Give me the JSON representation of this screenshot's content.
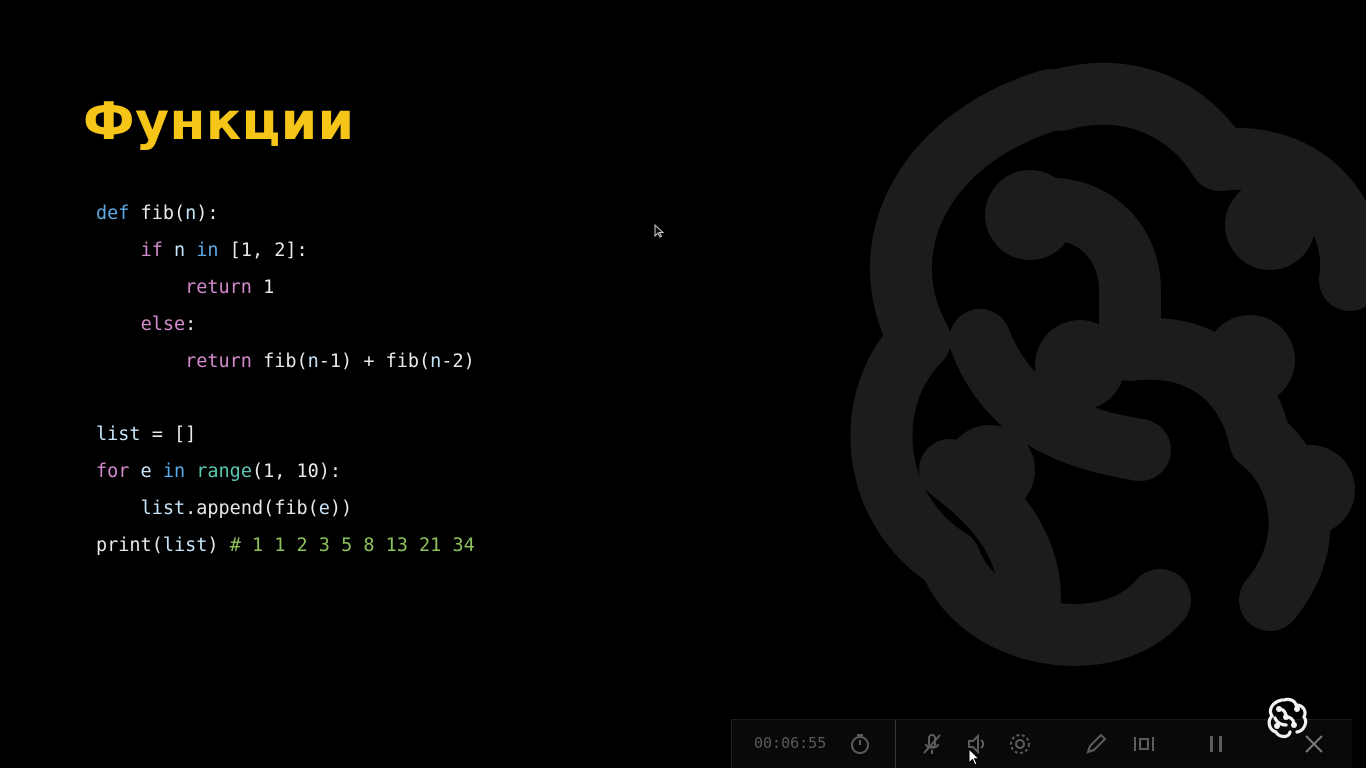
{
  "slide": {
    "title": "Функции"
  },
  "code": {
    "lines": [
      {
        "indent": "",
        "tokens": [
          {
            "t": "def",
            "c": "kw"
          },
          {
            "t": " fib(",
            "c": "fn"
          },
          {
            "t": "n",
            "c": "var"
          },
          {
            "t": "):",
            "c": "fn"
          }
        ]
      },
      {
        "indent": "    ",
        "tokens": [
          {
            "t": "if",
            "c": "ctl"
          },
          {
            "t": " n ",
            "c": "var"
          },
          {
            "t": "in",
            "c": "kw"
          },
          {
            "t": " [1, 2]:",
            "c": "num"
          }
        ]
      },
      {
        "indent": "        ",
        "tokens": [
          {
            "t": "return",
            "c": "ctl"
          },
          {
            "t": " 1",
            "c": "num"
          }
        ]
      },
      {
        "indent": "    ",
        "tokens": [
          {
            "t": "else",
            "c": "ctl"
          },
          {
            "t": ":",
            "c": "fn"
          }
        ]
      },
      {
        "indent": "        ",
        "tokens": [
          {
            "t": "return",
            "c": "ctl"
          },
          {
            "t": " fib(",
            "c": "fn"
          },
          {
            "t": "n",
            "c": "var"
          },
          {
            "t": "-1) + fib(",
            "c": "fn"
          },
          {
            "t": "n",
            "c": "var"
          },
          {
            "t": "-2)",
            "c": "fn"
          }
        ]
      },
      {
        "indent": "",
        "tokens": []
      },
      {
        "indent": "",
        "tokens": [
          {
            "t": "list",
            "c": "var"
          },
          {
            "t": " = []",
            "c": "fn"
          }
        ]
      },
      {
        "indent": "",
        "tokens": [
          {
            "t": "for",
            "c": "ctl"
          },
          {
            "t": " e ",
            "c": "var"
          },
          {
            "t": "in",
            "c": "kw"
          },
          {
            "t": " ",
            "c": "fn"
          },
          {
            "t": "range",
            "c": "bi"
          },
          {
            "t": "(1, 10):",
            "c": "num"
          }
        ]
      },
      {
        "indent": "    ",
        "tokens": [
          {
            "t": "list",
            "c": "var"
          },
          {
            "t": ".append(fib(",
            "c": "fn"
          },
          {
            "t": "e",
            "c": "var"
          },
          {
            "t": "))",
            "c": "fn"
          }
        ]
      },
      {
        "indent": "",
        "tokens": [
          {
            "t": "print",
            "c": "fn"
          },
          {
            "t": "(",
            "c": "fn"
          },
          {
            "t": "list",
            "c": "var"
          },
          {
            "t": ") ",
            "c": "fn"
          },
          {
            "t": "# 1 1 2 3 5 8 13 21 34",
            "c": "cm"
          }
        ]
      }
    ]
  },
  "toolbar": {
    "time": "00:06:55",
    "buttons": [
      {
        "name": "timer-icon"
      },
      {
        "name": "mic-muted-icon"
      },
      {
        "name": "volume-icon"
      },
      {
        "name": "settings-icon"
      },
      {
        "name": "pen-icon"
      },
      {
        "name": "screen-share-icon"
      },
      {
        "name": "pause-icon"
      },
      {
        "name": "close-icon"
      }
    ]
  },
  "colors": {
    "title": "#f5c518",
    "background": "#000000",
    "keyword": "#5aa8e4",
    "control": "#d38acb",
    "variable": "#c6e4f8",
    "builtin": "#5bc7b3",
    "comment": "#8cc15c"
  }
}
